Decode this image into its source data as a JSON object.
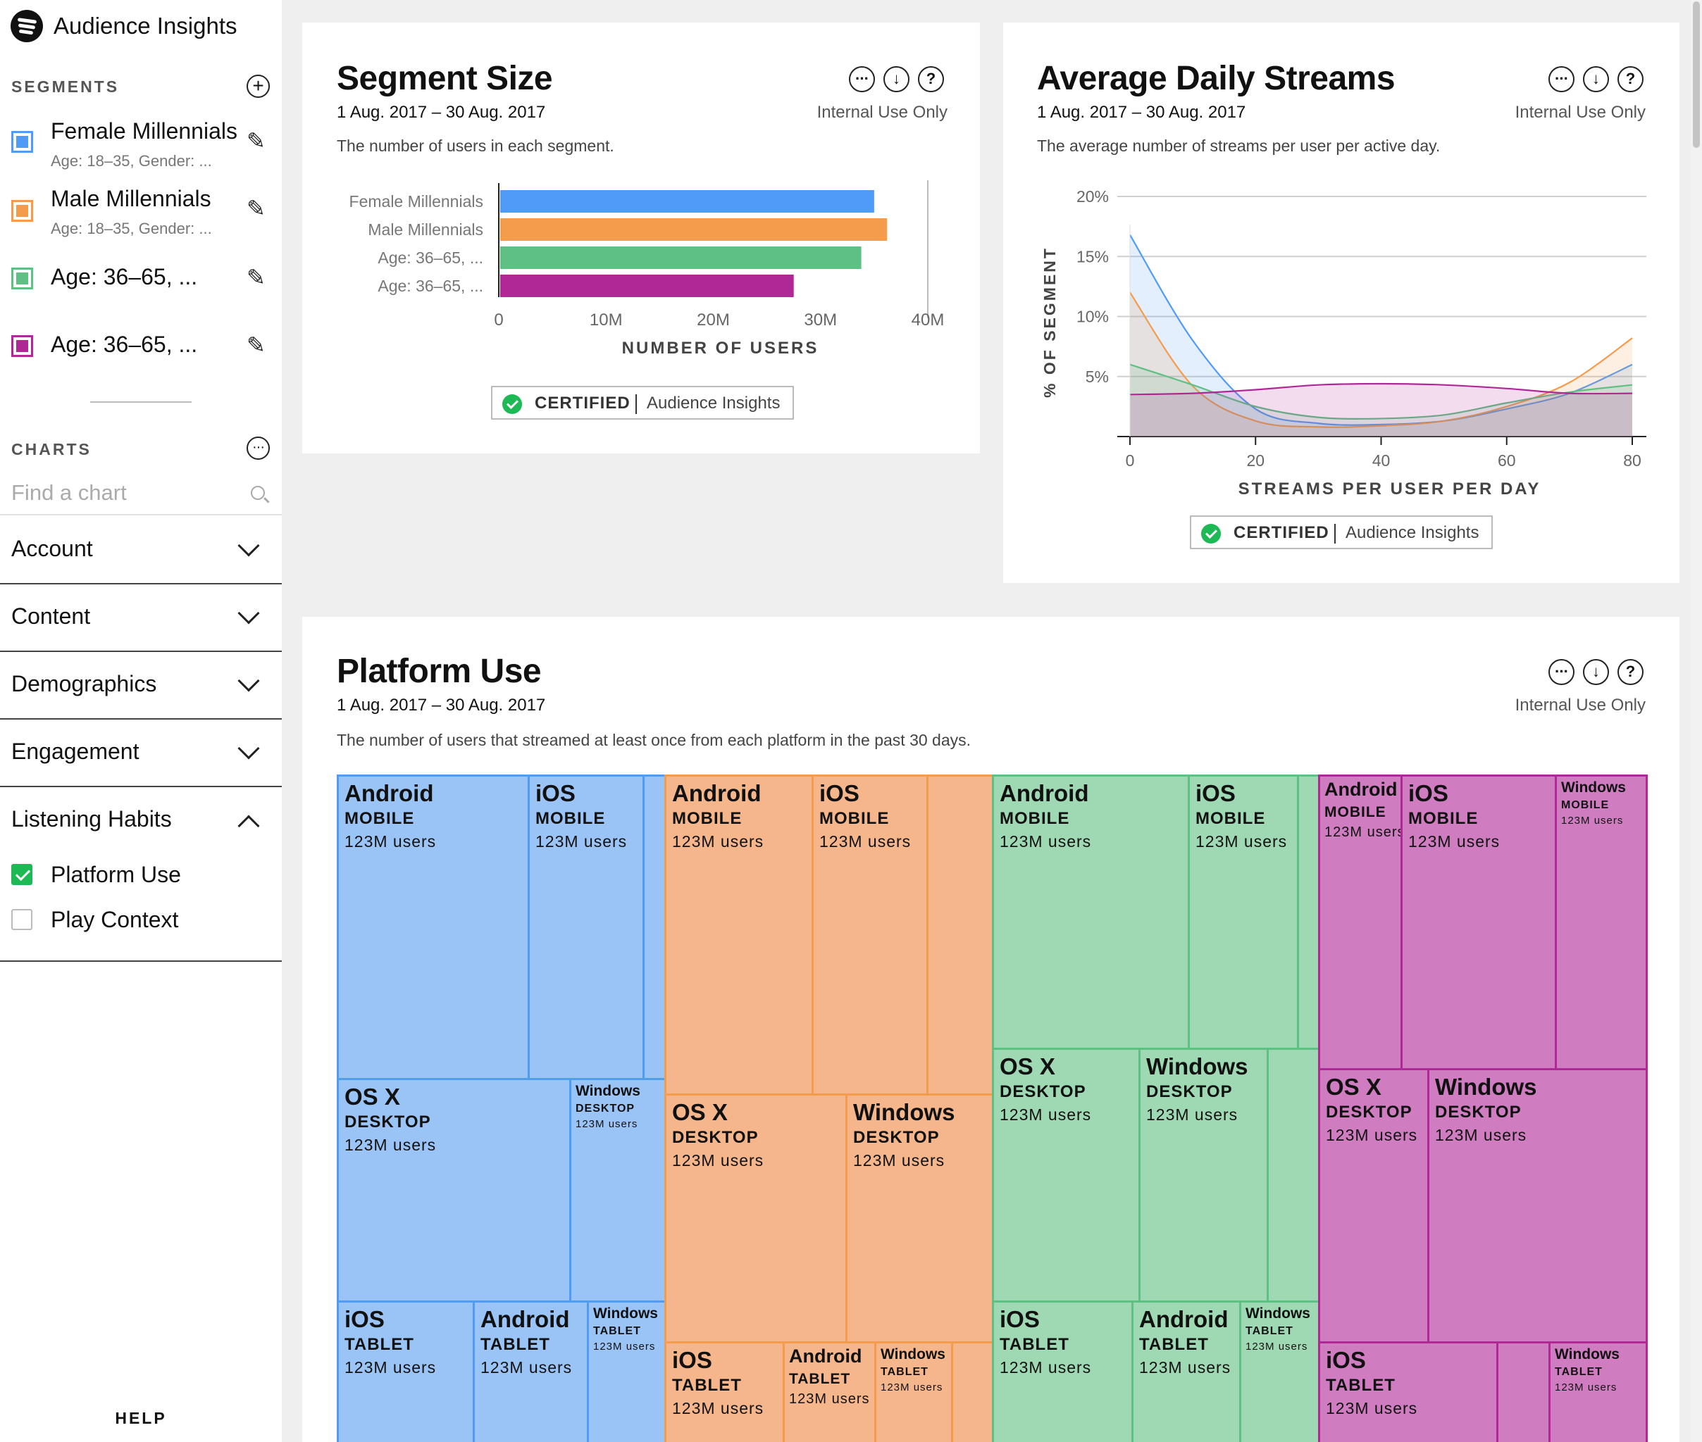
{
  "app": {
    "title": "Audience Insights"
  },
  "sidebar": {
    "segments_heading": "SEGMENTS",
    "segments": [
      {
        "name": "Female Millennials",
        "sub": "Age: 18–35, Gender: ...",
        "color": "#509bf5"
      },
      {
        "name": "Male Millennials",
        "sub": "Age: 18–35, Gender: ...",
        "color": "#f59b4c"
      },
      {
        "name": "Age: 36–65, ...",
        "sub": "",
        "color": "#5fc084"
      },
      {
        "name": "Age: 36–65, ...",
        "sub": "",
        "color": "#af2896"
      }
    ],
    "charts_heading": "CHARTS",
    "search_placeholder": "Find a chart",
    "categories": [
      {
        "label": "Account",
        "expanded": false
      },
      {
        "label": "Content",
        "expanded": false
      },
      {
        "label": "Demographics",
        "expanded": false
      },
      {
        "label": "Engagement",
        "expanded": false
      },
      {
        "label": "Listening Habits",
        "expanded": true
      }
    ],
    "listening_items": [
      {
        "label": "Platform Use",
        "checked": true
      },
      {
        "label": "Play Context",
        "checked": false
      }
    ],
    "help": "HELP"
  },
  "cards": {
    "segment_size": {
      "title": "Segment Size",
      "date": "1 Aug. 2017 – 30 Aug. 2017",
      "internal": "Internal Use Only",
      "description": "The number of users in each segment.",
      "certified": "CERTIFIED",
      "certified_by": "Audience Insights"
    },
    "avg_daily_streams": {
      "title": "Average Daily Streams",
      "date": "1 Aug. 2017 – 30 Aug. 2017",
      "internal": "Internal Use Only",
      "description": "The average number of streams per user per active day.",
      "certified": "CERTIFIED",
      "certified_by": "Audience Insights"
    },
    "platform_use": {
      "title": "Platform Use",
      "date": "1 Aug. 2017 – 30 Aug. 2017",
      "internal": "Internal Use Only",
      "description": "The number of users that streamed at least once from each platform in the past 30 days."
    }
  },
  "chart_data": [
    {
      "type": "bar",
      "orientation": "horizontal",
      "categories": [
        "Female Millennials",
        "Male Millennials",
        "Age: 36–65, ...",
        "Age: 36–65, ..."
      ],
      "values": [
        35000000,
        36200000,
        33800000,
        27500000
      ],
      "colors": [
        "#509bf5",
        "#f59b4c",
        "#5fc084",
        "#af2896"
      ],
      "xlabel": "NUMBER OF USERS",
      "xlim": [
        0,
        40000000
      ],
      "xticks": [
        "0",
        "10M",
        "20M",
        "30M",
        "40M"
      ],
      "grid": false
    },
    {
      "type": "area",
      "xlabel": "STREAMS PER USER PER DAY",
      "ylabel": "% OF SEGMENT",
      "xlim": [
        0,
        80
      ],
      "ylim": [
        0,
        20
      ],
      "xticks": [
        "0",
        "20",
        "40",
        "60",
        "80"
      ],
      "yticks": [
        "20%",
        "15%",
        "10%",
        "5%"
      ],
      "grid": true,
      "series": [
        {
          "color": "#509bf5",
          "x": [
            0,
            10,
            20,
            30,
            40,
            50,
            60,
            70,
            80
          ],
          "y": [
            16.8,
            8.0,
            2.3,
            1.1,
            1.0,
            1.3,
            2.3,
            3.6,
            6.0
          ]
        },
        {
          "color": "#f59b4c",
          "x": [
            0,
            10,
            20,
            30,
            40,
            50,
            60,
            70,
            80
          ],
          "y": [
            12.0,
            4.2,
            1.3,
            0.8,
            0.9,
            1.3,
            2.5,
            4.5,
            8.2
          ]
        },
        {
          "color": "#5fc084",
          "x": [
            0,
            10,
            20,
            30,
            40,
            50,
            60,
            70,
            80
          ],
          "y": [
            6.0,
            4.3,
            2.5,
            1.6,
            1.5,
            1.8,
            2.8,
            3.7,
            4.3
          ]
        },
        {
          "color": "#af2896",
          "x": [
            0,
            10,
            20,
            30,
            40,
            50,
            60,
            70,
            80
          ],
          "y": [
            3.5,
            3.6,
            3.9,
            4.3,
            4.4,
            4.3,
            4.0,
            3.6,
            3.6
          ]
        }
      ]
    },
    {
      "type": "treemap",
      "groups": [
        {
          "segment": "Female Millennials",
          "color": "#509bf5",
          "fill": "#9bc4f6",
          "tiles": [
            {
              "os": "Android",
              "device": "MOBILE",
              "users": "123M users"
            },
            {
              "os": "iOS",
              "device": "MOBILE",
              "users": "123M users"
            },
            {
              "os": "OS X",
              "device": "DESKTOP",
              "users": "123M users"
            },
            {
              "os": "Windows",
              "device": "DESKTOP",
              "users": "123M users"
            },
            {
              "os": "iOS",
              "device": "TABLET",
              "users": "123M users"
            },
            {
              "os": "Android",
              "device": "TABLET",
              "users": "123M users"
            },
            {
              "os": "Windows",
              "device": "TABLET",
              "users": "123M users"
            }
          ]
        },
        {
          "segment": "Male Millennials",
          "color": "#f59b4c",
          "fill": "#f5b68c",
          "tiles": [
            {
              "os": "Android",
              "device": "MOBILE",
              "users": "123M users"
            },
            {
              "os": "iOS",
              "device": "MOBILE",
              "users": "123M users"
            },
            {
              "os": "OS X",
              "device": "DESKTOP",
              "users": "123M users"
            },
            {
              "os": "Windows",
              "device": "DESKTOP",
              "users": "123M users"
            },
            {
              "os": "iOS",
              "device": "TABLET",
              "users": "123M users"
            },
            {
              "os": "Android",
              "device": "TABLET",
              "users": "123M users"
            },
            {
              "os": "Windows",
              "device": "TABLET",
              "users": "123M users"
            }
          ]
        },
        {
          "segment": "Age: 36–65, ...",
          "color": "#5fc084",
          "fill": "#9ed9b4",
          "tiles": [
            {
              "os": "Android",
              "device": "MOBILE",
              "users": "123M users"
            },
            {
              "os": "iOS",
              "device": "MOBILE",
              "users": "123M users"
            },
            {
              "os": "OS X",
              "device": "DESKTOP",
              "users": "123M users"
            },
            {
              "os": "Windows",
              "device": "DESKTOP",
              "users": "123M users"
            },
            {
              "os": "iOS",
              "device": "TABLET",
              "users": "123M users"
            },
            {
              "os": "Android",
              "device": "TABLET",
              "users": "123M users"
            },
            {
              "os": "Windows",
              "device": "TABLET",
              "users": "123M users"
            }
          ]
        },
        {
          "segment": "Age: 36–65, ...",
          "color": "#af2896",
          "fill": "#cf7dc0",
          "tiles": [
            {
              "os": "Android",
              "device": "MOBILE",
              "users": "123M users"
            },
            {
              "os": "iOS",
              "device": "MOBILE",
              "users": "123M users"
            },
            {
              "os": "Windows",
              "device": "MOBILE",
              "users": "123M users"
            },
            {
              "os": "OS X",
              "device": "DESKTOP",
              "users": "123M users"
            },
            {
              "os": "Windows",
              "device": "DESKTOP",
              "users": "123M users"
            },
            {
              "os": "iOS",
              "device": "TABLET",
              "users": "123M users"
            },
            {
              "os": "Windows",
              "device": "TABLET",
              "users": "123M users"
            }
          ]
        }
      ]
    }
  ]
}
